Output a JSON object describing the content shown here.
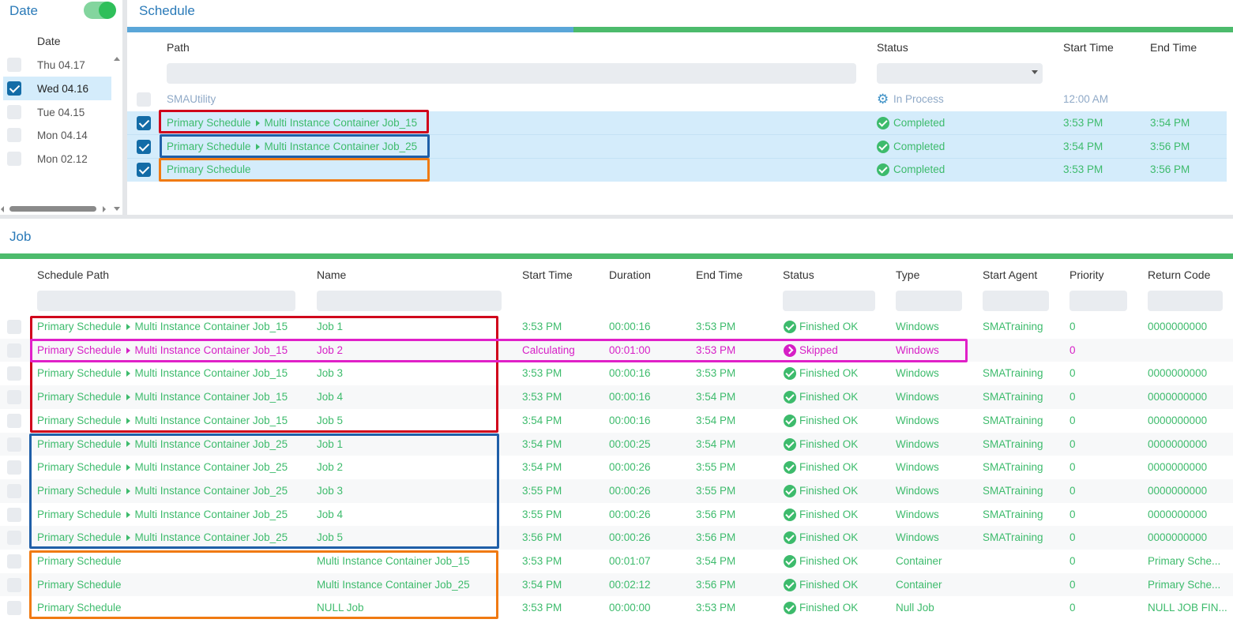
{
  "date_panel": {
    "title": "Date",
    "toggle_on": true,
    "column_header": "Date",
    "dates": [
      {
        "label": "Thu 04.17",
        "checked": false
      },
      {
        "label": "Wed 04.16",
        "checked": true
      },
      {
        "label": "Tue 04.15",
        "checked": false
      },
      {
        "label": "Mon 04.14",
        "checked": false
      },
      {
        "label": "Mon 02.12",
        "checked": false
      }
    ]
  },
  "schedule_panel": {
    "title": "Schedule",
    "columns": {
      "path": "Path",
      "status": "Status",
      "start": "Start Time",
      "end": "End Time"
    },
    "rows": [
      {
        "path": "SMAUtility",
        "status": "In Process",
        "status_icon": "gear-icon",
        "start": "12:00 AM",
        "end": "",
        "checked": false
      },
      {
        "path_parts": [
          "Primary Schedule",
          "Multi Instance Container Job_15"
        ],
        "status": "Completed",
        "status_icon": "check-circle-icon",
        "start": "3:53 PM",
        "end": "3:54 PM",
        "checked": true
      },
      {
        "path_parts": [
          "Primary Schedule",
          "Multi Instance Container Job_25"
        ],
        "status": "Completed",
        "status_icon": "check-circle-icon",
        "start": "3:54 PM",
        "end": "3:56 PM",
        "checked": true
      },
      {
        "path_parts": [
          "Primary Schedule"
        ],
        "status": "Completed",
        "status_icon": "check-circle-icon",
        "start": "3:53 PM",
        "end": "3:56 PM",
        "checked": true
      }
    ]
  },
  "job_panel": {
    "title": "Job",
    "columns": {
      "schedule_path": "Schedule Path",
      "name": "Name",
      "start": "Start Time",
      "duration": "Duration",
      "end": "End Time",
      "status": "Status",
      "type": "Type",
      "agent": "Start Agent",
      "priority": "Priority",
      "return_code": "Return Code"
    },
    "rows": [
      {
        "sched": "Primary Schedule",
        "sub": "Multi Instance Container Job_15",
        "name": "Job 1",
        "start": "3:53 PM",
        "duration": "00:00:16",
        "end": "3:53 PM",
        "status": "Finished OK",
        "type": "Windows",
        "agent": "SMATraining",
        "priority": "0",
        "rc": "0000000000"
      },
      {
        "sched": "Primary Schedule",
        "sub": "Multi Instance Container Job_15",
        "name": "Job 2",
        "start": "Calculating",
        "duration": "00:01:00",
        "end": "3:53 PM",
        "status": "Skipped",
        "type": "Windows",
        "agent": "",
        "priority": "0",
        "rc": "",
        "skipped": true
      },
      {
        "sched": "Primary Schedule",
        "sub": "Multi Instance Container Job_15",
        "name": "Job 3",
        "start": "3:53 PM",
        "duration": "00:00:16",
        "end": "3:53 PM",
        "status": "Finished OK",
        "type": "Windows",
        "agent": "SMATraining",
        "priority": "0",
        "rc": "0000000000"
      },
      {
        "sched": "Primary Schedule",
        "sub": "Multi Instance Container Job_15",
        "name": "Job 4",
        "start": "3:53 PM",
        "duration": "00:00:16",
        "end": "3:54 PM",
        "status": "Finished OK",
        "type": "Windows",
        "agent": "SMATraining",
        "priority": "0",
        "rc": "0000000000"
      },
      {
        "sched": "Primary Schedule",
        "sub": "Multi Instance Container Job_15",
        "name": "Job 5",
        "start": "3:54 PM",
        "duration": "00:00:16",
        "end": "3:54 PM",
        "status": "Finished OK",
        "type": "Windows",
        "agent": "SMATraining",
        "priority": "0",
        "rc": "0000000000"
      },
      {
        "sched": "Primary Schedule",
        "sub": "Multi Instance Container Job_25",
        "name": "Job 1",
        "start": "3:54 PM",
        "duration": "00:00:25",
        "end": "3:54 PM",
        "status": "Finished OK",
        "type": "Windows",
        "agent": "SMATraining",
        "priority": "0",
        "rc": "0000000000"
      },
      {
        "sched": "Primary Schedule",
        "sub": "Multi Instance Container Job_25",
        "name": "Job 2",
        "start": "3:54 PM",
        "duration": "00:00:26",
        "end": "3:55 PM",
        "status": "Finished OK",
        "type": "Windows",
        "agent": "SMATraining",
        "priority": "0",
        "rc": "0000000000"
      },
      {
        "sched": "Primary Schedule",
        "sub": "Multi Instance Container Job_25",
        "name": "Job 3",
        "start": "3:55 PM",
        "duration": "00:00:26",
        "end": "3:55 PM",
        "status": "Finished OK",
        "type": "Windows",
        "agent": "SMATraining",
        "priority": "0",
        "rc": "0000000000"
      },
      {
        "sched": "Primary Schedule",
        "sub": "Multi Instance Container Job_25",
        "name": "Job 4",
        "start": "3:55 PM",
        "duration": "00:00:26",
        "end": "3:56 PM",
        "status": "Finished OK",
        "type": "Windows",
        "agent": "SMATraining",
        "priority": "0",
        "rc": "0000000000"
      },
      {
        "sched": "Primary Schedule",
        "sub": "Multi Instance Container Job_25",
        "name": "Job 5",
        "start": "3:56 PM",
        "duration": "00:00:26",
        "end": "3:56 PM",
        "status": "Finished OK",
        "type": "Windows",
        "agent": "SMATraining",
        "priority": "0",
        "rc": "0000000000"
      },
      {
        "sched": "Primary Schedule",
        "sub": "",
        "name": "Multi Instance Container Job_15",
        "start": "3:53 PM",
        "duration": "00:01:07",
        "end": "3:54 PM",
        "status": "Finished OK",
        "type": "Container",
        "agent": "",
        "priority": "0",
        "rc": "Primary Sche..."
      },
      {
        "sched": "Primary Schedule",
        "sub": "",
        "name": "Multi Instance Container Job_25",
        "start": "3:54 PM",
        "duration": "00:02:12",
        "end": "3:56 PM",
        "status": "Finished OK",
        "type": "Container",
        "agent": "",
        "priority": "0",
        "rc": "Primary Sche..."
      },
      {
        "sched": "Primary Schedule",
        "sub": "",
        "name": "NULL Job",
        "start": "3:53 PM",
        "duration": "00:00:00",
        "end": "3:53 PM",
        "status": "Finished OK",
        "type": "Null Job",
        "agent": "",
        "priority": "0",
        "rc": "NULL JOB FIN..."
      }
    ]
  },
  "colors": {
    "accent_blue": "#2a7ab8",
    "progress_blue": "#5aa6d8",
    "progress_green": "#4cbb6c",
    "status_green": "#3dbb6c",
    "skipped_magenta": "#d61fc6",
    "highlight_red": "#d0021b",
    "highlight_blue": "#1f5fa8",
    "highlight_orange": "#f07a12",
    "highlight_magenta": "#e020c8",
    "selected_row": "#d4ecfb"
  }
}
